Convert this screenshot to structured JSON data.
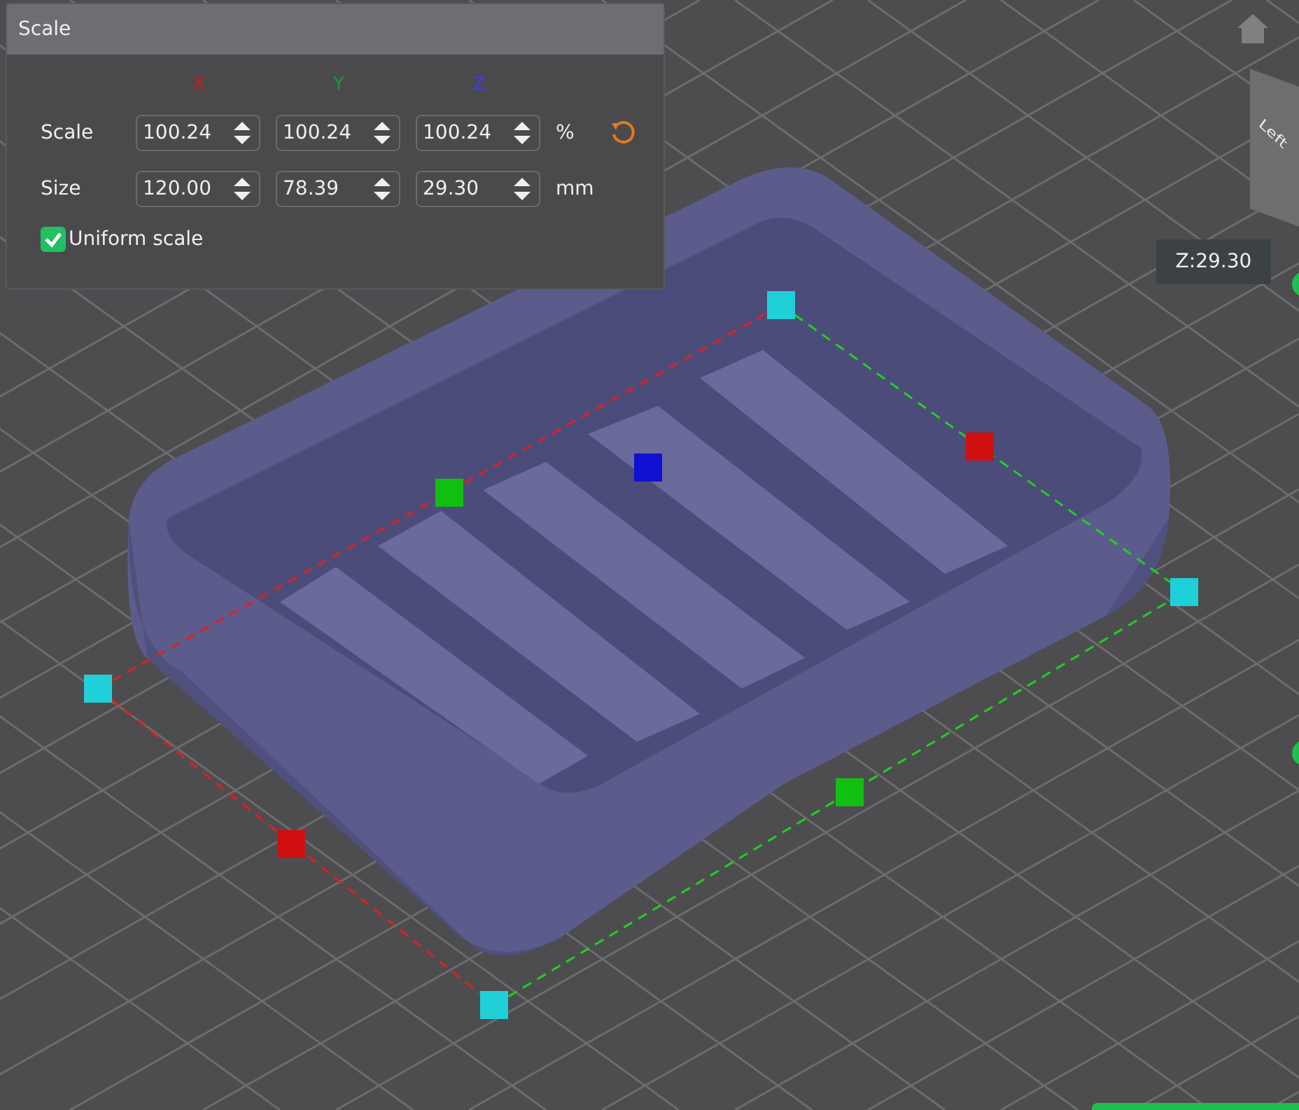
{
  "panel": {
    "title": "Scale",
    "axes": [
      {
        "label": "X",
        "color": "#d01818"
      },
      {
        "label": "Y",
        "color": "#189a30"
      },
      {
        "label": "Z",
        "color": "#3a3aff"
      }
    ],
    "rows": [
      {
        "label": "Scale",
        "values": [
          "100.24",
          "100.24",
          "100.24"
        ],
        "unit": "%",
        "reset": true
      },
      {
        "label": "Size",
        "values": [
          "120.00",
          "78.39",
          "29.30"
        ],
        "unit": "mm",
        "reset": false
      }
    ],
    "uniform_scale": {
      "label": "Uniform scale",
      "checked": true
    }
  },
  "viewport": {
    "z_readout": "Z:29.30",
    "view_cube_face": "Left"
  }
}
